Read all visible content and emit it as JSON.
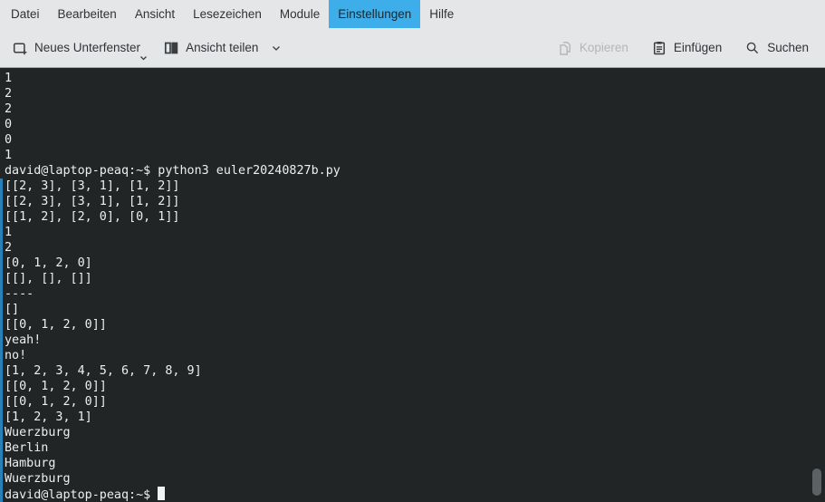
{
  "menu_bar": {
    "items": [
      {
        "label": "Datei"
      },
      {
        "label": "Bearbeiten"
      },
      {
        "label": "Ansicht"
      },
      {
        "label": "Lesezeichen"
      },
      {
        "label": "Module"
      },
      {
        "label": "Einstellungen",
        "active": true
      },
      {
        "label": "Hilfe"
      }
    ]
  },
  "toolbar": {
    "new_tab_label": "Neues Unterfenster",
    "split_view_label": "Ansicht teilen",
    "copy_label": "Kopieren",
    "paste_label": "Einfügen",
    "search_label": "Suchen",
    "copy_disabled": true
  },
  "terminal": {
    "prompt": "david@laptop-peaq:~$",
    "command": "python3 euler20240827b.py",
    "cursor": "block",
    "lines": [
      {
        "text": "1"
      },
      {
        "text": "2"
      },
      {
        "text": "2"
      },
      {
        "text": "0"
      },
      {
        "text": "0"
      },
      {
        "text": "1"
      },
      {
        "text": "david@laptop-peaq:~$ python3 euler20240827b.py",
        "prompt": true
      },
      {
        "text": "[[2, 3], [3, 1], [1, 2]]",
        "new_output": true
      },
      {
        "text": "[[2, 3], [3, 1], [1, 2]]",
        "new_output": true
      },
      {
        "text": "[[1, 2], [2, 0], [0, 1]]",
        "new_output": true
      },
      {
        "text": "1",
        "new_output": true
      },
      {
        "text": "2",
        "new_output": true
      },
      {
        "text": "[0, 1, 2, 0]",
        "new_output": true
      },
      {
        "text": "[[], [], []]",
        "new_output": true
      },
      {
        "text": "----",
        "new_output": true
      },
      {
        "text": "[]",
        "new_output": true
      },
      {
        "text": "[[0, 1, 2, 0]]",
        "new_output": true
      },
      {
        "text": "yeah!",
        "new_output": true
      },
      {
        "text": "no!",
        "new_output": true
      },
      {
        "text": "[1, 2, 3, 4, 5, 6, 7, 8, 9]",
        "new_output": true
      },
      {
        "text": "[[0, 1, 2, 0]]",
        "new_output": true
      },
      {
        "text": "[[0, 1, 2, 0]]",
        "new_output": true
      },
      {
        "text": "[1, 2, 3, 1]",
        "new_output": true
      },
      {
        "text": "Wuerzburg",
        "new_output": true
      },
      {
        "text": "Berlin",
        "new_output": true
      },
      {
        "text": "Hamburg",
        "new_output": true
      },
      {
        "text": "Wuerzburg",
        "new_output": true
      },
      {
        "text": "david@laptop-peaq:~$ ",
        "new_output": true,
        "prompt": true,
        "cursor": true
      }
    ]
  },
  "colors": {
    "accent": "#3daee9",
    "chrome_bg": "#e5e6e7",
    "terminal_bg": "#222526",
    "terminal_fg": "#edeff0",
    "new_line_marker": "#2980b9",
    "disabled_text": "#b3b7b9"
  }
}
